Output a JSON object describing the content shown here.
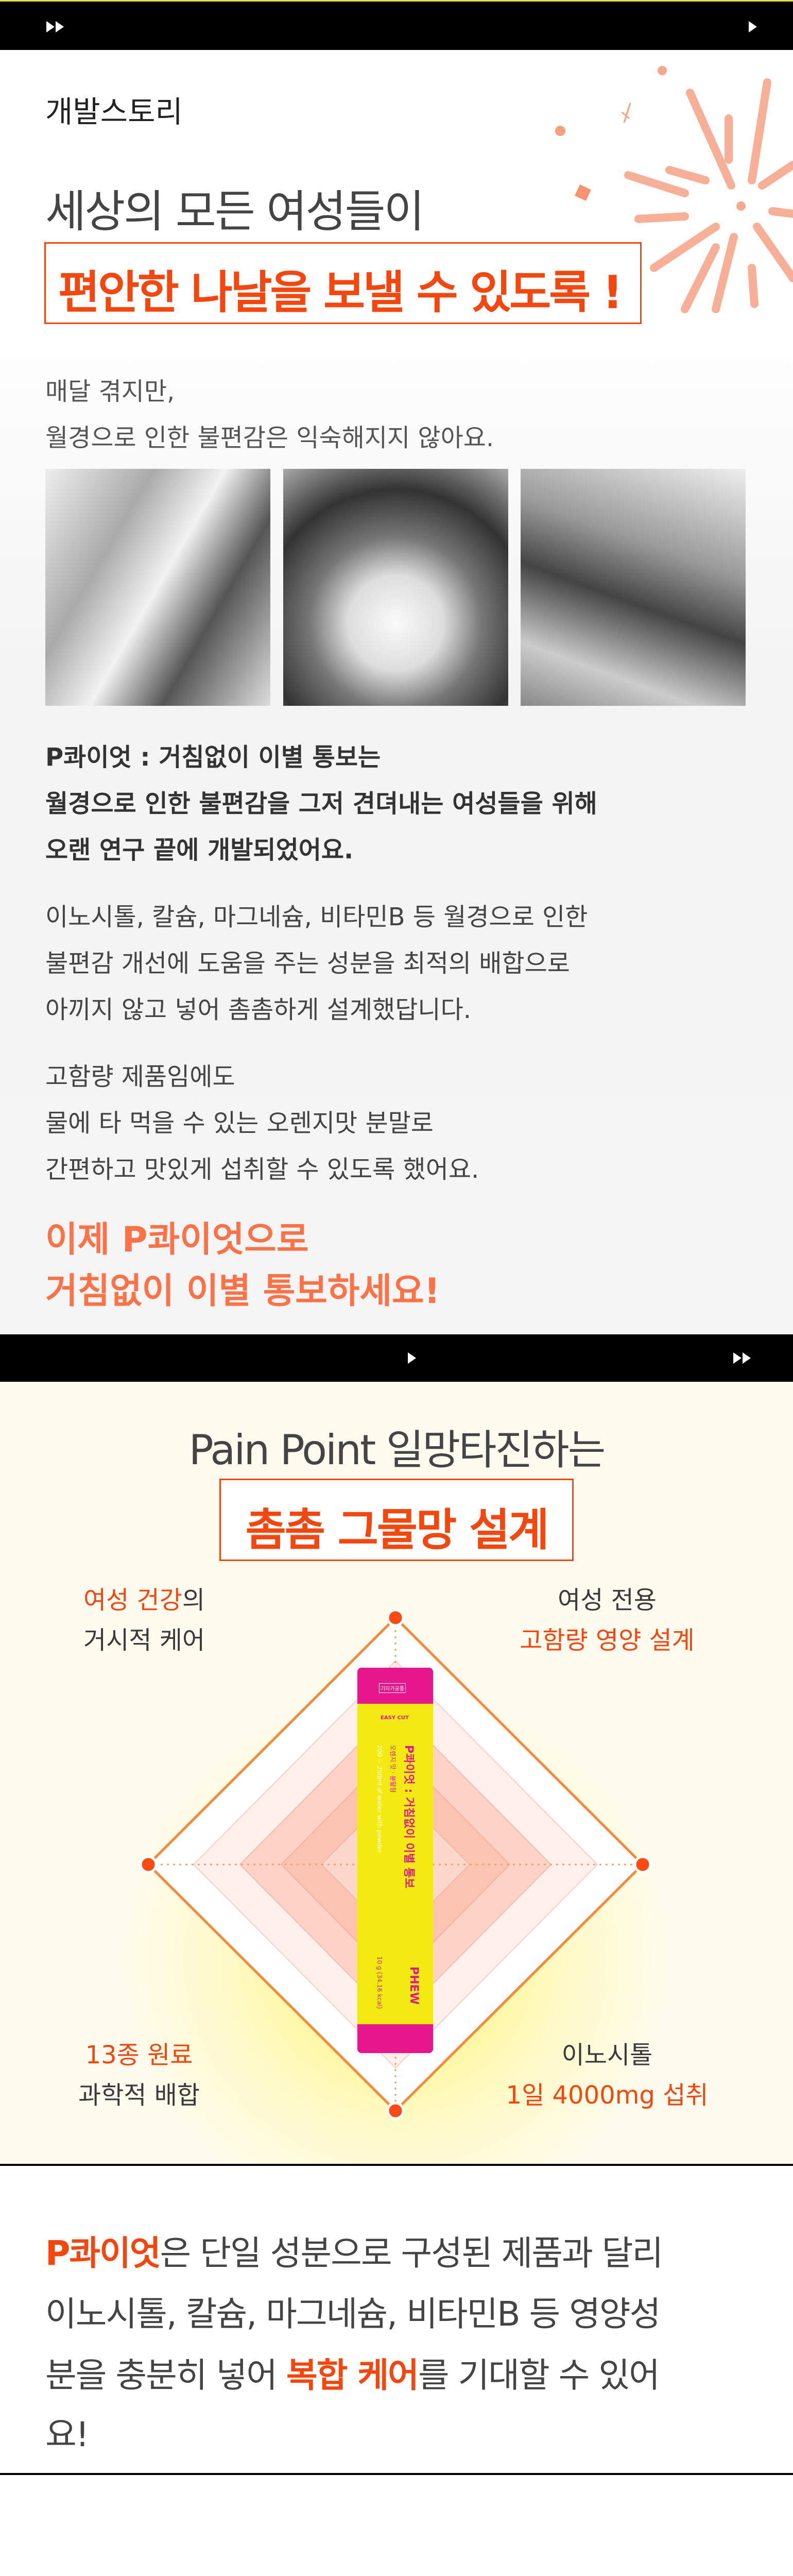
{
  "nav_top": {
    "left_icon": "fast-forward-icon",
    "right_icon": "play-icon"
  },
  "story": {
    "label": "개발스토리",
    "headline": "세상의 모든 여성들이",
    "headline_box": "편안한 나날을 보낼 수 있도록 !",
    "intro": [
      "매달 겪지만,",
      "월경으로 인한 불편감은 익숙해지지 않아요."
    ],
    "photos": [
      "lab-researchers-photo",
      "mixing-powder-photo",
      "lab-overhead-photo"
    ],
    "bold_para": [
      "P콰이엇 : 거침없이 이별 통보는",
      "월경으로 인한 불편감을 그저 견뎌내는 여성들을 위해",
      "오랜 연구 끝에 개발되었어요."
    ],
    "para2": [
      "이노시톨, 칼슘, 마그네슘, 비타민B 등 월경으로 인한",
      "불편감 개선에 도움을 주는 성분을 최적의 배합으로",
      "아끼지 않고 넣어 촘촘하게 설계했답니다."
    ],
    "para3": [
      "고함량 제품임에도",
      "물에 타 먹을 수 있는 오렌지맛 분말로",
      "간편하고 맛있게 섭취할 수 있도록 했어요."
    ],
    "cta": [
      "이제 P콰이엇으로",
      "거침없이 이별 통보하세요!"
    ]
  },
  "nav_mid": {
    "center_icon": "play-icon",
    "right_icon": "fast-forward-icon"
  },
  "painpoint": {
    "title": "Pain Point 일망타진하는",
    "title_box": "촘촘 그물망 설계",
    "labels": {
      "top_left": {
        "hl": "여성 건강",
        "rest": "의",
        "line2": "거시적 케어"
      },
      "top_right": {
        "line1": "여성 전용",
        "hl": "고함량 영양 설계"
      },
      "bottom_left": {
        "hl": "13종 원료",
        "line2": "과학적 배합"
      },
      "bottom_right": {
        "line1": "이노시톨",
        "hl": "1일 4000mg 섭취"
      }
    },
    "product": {
      "tag": "기타가공품",
      "cut": "EASY CUT",
      "name": "P콰이엇 : 거침없이 이별 통보",
      "flavor": "오렌지 맛 · 분말형",
      "usage": "200 ~ 250ml of water with powder",
      "weight": "10 g (34.16 kcal)",
      "brand": "PHEW"
    }
  },
  "summary": {
    "line1_hl": "P콰이엇",
    "line1_rest": "은 단일 성분으로 구성된 제품과 달리",
    "line2": "이노시톨, 칼슘, 마그네슘, 비타민B 등 영양성",
    "line3_a": "분을 충분히 넣어 ",
    "line3_hl": "복합 케어",
    "line3_b": "를 기대할 수 있어",
    "line4": "요!"
  },
  "colors": {
    "accent": "#f4470f",
    "cta": "#ff7248",
    "text": "#444444",
    "magenta": "#e6178c",
    "yellow": "#f3ea12"
  }
}
